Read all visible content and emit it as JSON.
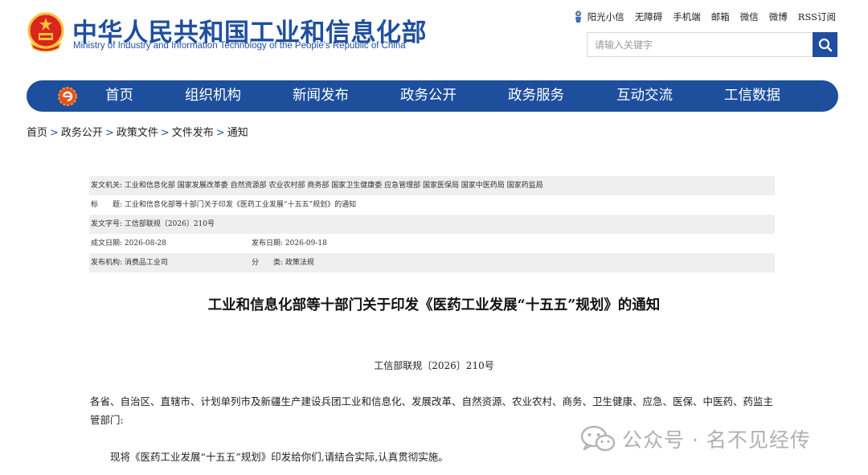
{
  "header": {
    "brand_cn": "中华人民共和国工业和信息化部",
    "brand_en": "Ministry of Industry and Information Technology of the People's Republic of China",
    "top_links": [
      "阳光小信",
      "无障碍",
      "手机端",
      "邮箱",
      "微信",
      "微博",
      "RSS订阅"
    ],
    "search_placeholder": "请输入关键字"
  },
  "nav": {
    "items": [
      "首页",
      "组织机构",
      "新闻发布",
      "政务公开",
      "政务服务",
      "互动交流",
      "工信数据"
    ]
  },
  "breadcrumb": [
    "首页",
    "政务公开",
    "政策文件",
    "文件发布",
    "通知"
  ],
  "meta": {
    "issuer_label": "发文机关:",
    "issuer_value": "工业和信息化部 国家发展改革委 自然资源部 农业农村部 商务部 国家卫生健康委 应急管理部 国家医保局 国家中医药局 国家药监局",
    "title_label": "标　　题:",
    "title_value": "工业和信息化部等十部门关于印发《医药工业发展“十五五”规划》的通知",
    "docno_label": "发文字号:",
    "docno_value": "工信部联规〔2026〕210号",
    "date_label": "成文日期:",
    "date_value": "2026-08-28",
    "pubdate_label": "发布日期:",
    "pubdate_value": "2026-09-18",
    "org_label": "发布机构:",
    "org_value": "消费品工业司",
    "category_label": "分　　类:",
    "category_value": "政策法规"
  },
  "article": {
    "title": "工业和信息化部等十部门关于印发《医药工业发展“十五五”规划》的通知",
    "doc_number": "工信部联规〔2026〕210号",
    "addressee": "各省、自治区、直辖市、计划单列市及新疆生产建设兵团工业和信息化、发展改革、自然资源、农业农村、商务、卫生健康、应急、医保、中医药、药监主管部门:",
    "body": "现将《医药工业发展“十五五”规划》印发给你们,请结合实际,认真贯彻实施。"
  },
  "watermark": {
    "text": "公众号 · 名不见经传"
  },
  "colors": {
    "brand_blue": "#1f4f9e",
    "nav_blue": "#1d4f9d",
    "meta_shade": "#efefef"
  }
}
